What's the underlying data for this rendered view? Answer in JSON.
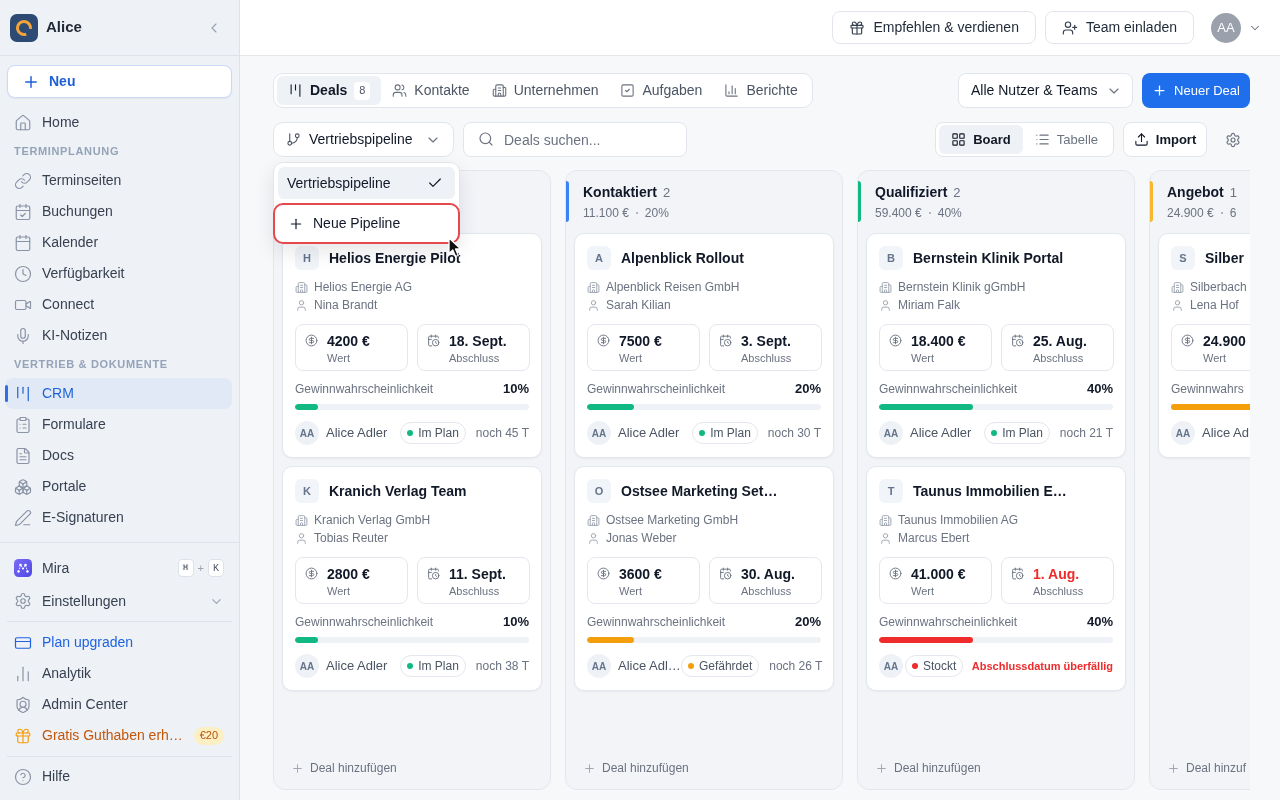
{
  "sidebar": {
    "workspace": "Alice",
    "new_button": "Neu",
    "nav": [
      {
        "kind": "link",
        "label": "Home",
        "selected": false
      },
      {
        "kind": "section",
        "label": "TERMINPLANUNG"
      },
      {
        "kind": "link",
        "label": "Terminseiten",
        "selected": false
      },
      {
        "kind": "link",
        "label": "Buchungen",
        "selected": false
      },
      {
        "kind": "link",
        "label": "Kalender",
        "selected": false
      },
      {
        "kind": "link",
        "label": "Verfügbarkeit",
        "selected": false
      },
      {
        "kind": "link",
        "label": "Connect",
        "selected": false
      },
      {
        "kind": "link",
        "label": "KI-Notizen",
        "selected": false
      },
      {
        "kind": "section",
        "label": "VERTRIEB & DOKUMENTE"
      },
      {
        "kind": "link",
        "label": "CRM",
        "selected": true
      },
      {
        "kind": "link",
        "label": "Formulare",
        "selected": false
      },
      {
        "kind": "link",
        "label": "Docs",
        "selected": false
      },
      {
        "kind": "link",
        "label": "Portale",
        "selected": false
      },
      {
        "kind": "link",
        "label": "E-Signaturen",
        "selected": false
      }
    ],
    "tools": [
      {
        "kind": "assistant",
        "label": "Mira",
        "shortcut": [
          "⌘",
          "+",
          "K"
        ]
      },
      {
        "kind": "expandable",
        "label": "Einstellungen",
        "expanded": false
      }
    ],
    "account": [
      {
        "kind": "upgrade",
        "label": "Plan upgraden"
      },
      {
        "kind": "link",
        "label": "Analytik"
      },
      {
        "kind": "link",
        "label": "Admin Center"
      },
      {
        "kind": "promo",
        "label": "Gratis Guthaben erh…",
        "badge": "€20"
      }
    ],
    "help": "Hilfe"
  },
  "top_bar": {
    "buttons": [
      "Empfehlen & verdienen",
      "Team einladen"
    ],
    "avatar": "AA"
  },
  "tabs": [
    {
      "label": "Deals",
      "count": "8",
      "selected": true
    },
    {
      "label": "Kontakte",
      "selected": false
    },
    {
      "label": "Unternehmen",
      "selected": false
    },
    {
      "label": "Aufgaben",
      "selected": false
    },
    {
      "label": "Berichte",
      "selected": false
    }
  ],
  "owner_filter": "Alle Nutzer & Teams",
  "new_deal_button": "Neuer Deal",
  "pipeline_select": {
    "value": "Vertriebspipeline",
    "expanded": true,
    "menu": [
      {
        "kind": "option",
        "label": "Vertriebspipeline",
        "selected": true,
        "highlighted": false
      },
      {
        "kind": "action",
        "label": "Neue Pipeline",
        "selected": false,
        "highlighted": true
      }
    ]
  },
  "search": {
    "placeholder": "Deals suchen..."
  },
  "view_toggle": [
    {
      "label": "Board",
      "selected": true
    },
    {
      "label": "Tabelle",
      "selected": false
    }
  ],
  "import_button": "Import",
  "columns": [
    {
      "cards": [
        {
          "initial": "H",
          "title": "Helios Energie Pilot",
          "company": "Helios Energie AG",
          "contact": "Nina Brandt",
          "value": "4200 €",
          "value_label": "Wert",
          "close_date": "18. Sept.",
          "close_label": "Abschluss",
          "overdue": false,
          "probability_label": "Gewinnwahrscheinlichkeit",
          "probability": "10%",
          "level": 0.1,
          "color": "#10b981",
          "owner_initials": "AA",
          "owner": "Alice Adler",
          "status": "Im Plan",
          "due": "noch 45 T"
        },
        {
          "initial": "K",
          "title": "Kranich Verlag Team",
          "company": "Kranich Verlag GmbH",
          "contact": "Tobias Reuter",
          "value": "2800 €",
          "value_label": "Wert",
          "close_date": "11. Sept.",
          "close_label": "Abschluss",
          "overdue": false,
          "probability_label": "Gewinnwahrscheinlichkeit",
          "probability": "10%",
          "level": 0.1,
          "color": "#10b981",
          "owner_initials": "AA",
          "owner": "Alice Adler",
          "status": "Im Plan",
          "due": "noch 38 T"
        }
      ],
      "add_button": "Deal hinzufügen"
    },
    {
      "title": "Kontaktiert",
      "count": "2",
      "total": "11.100 €",
      "probability": "20%",
      "color": "#3b82f6",
      "cards": [
        {
          "initial": "A",
          "title": "Alpenblick Rollout",
          "company": "Alpenblick Reisen GmbH",
          "contact": "Sarah Kilian",
          "value": "7500 €",
          "value_label": "Wert",
          "close_date": "3. Sept.",
          "close_label": "Abschluss",
          "overdue": false,
          "probability_label": "Gewinnwahrscheinlichkeit",
          "probability": "20%",
          "level": 0.2,
          "color": "#10b981",
          "owner_initials": "AA",
          "owner": "Alice Adler",
          "status": "Im Plan",
          "due": "noch 30 T"
        },
        {
          "initial": "O",
          "title": "Ostsee Marketing Set…",
          "company": "Ostsee Marketing GmbH",
          "contact": "Jonas Weber",
          "value": "3600 €",
          "value_label": "Wert",
          "close_date": "30. Aug.",
          "close_label": "Abschluss",
          "overdue": false,
          "probability_label": "Gewinnwahrscheinlichkeit",
          "probability": "20%",
          "level": 0.2,
          "color": "#f59e0b",
          "owner_initials": "AA",
          "owner": "Alice Adl…",
          "status": "Gefährdet",
          "due": "noch 26 T"
        }
      ],
      "add_button": "Deal hinzufügen"
    },
    {
      "title": "Qualifiziert",
      "count": "2",
      "total": "59.400 €",
      "probability": "40%",
      "color": "#10b981",
      "cards": [
        {
          "initial": "B",
          "title": "Bernstein Klinik Portal",
          "company": "Bernstein Klinik gGmbH",
          "contact": "Miriam Falk",
          "value": "18.400 €",
          "value_label": "Wert",
          "close_date": "25. Aug.",
          "close_label": "Abschluss",
          "overdue": false,
          "probability_label": "Gewinnwahrscheinlichkeit",
          "probability": "40%",
          "level": 0.4,
          "color": "#10b981",
          "owner_initials": "AA",
          "owner": "Alice Adler",
          "status": "Im Plan",
          "due": "noch 21 T"
        },
        {
          "initial": "T",
          "title": "Taunus Immobilien E…",
          "company": "Taunus Immobilien AG",
          "contact": "Marcus Ebert",
          "value": "41.000 €",
          "value_label": "Wert",
          "close_date": "1. Aug.",
          "close_label": "Abschluss",
          "overdue": true,
          "probability_label": "Gewinnwahrscheinlichkeit",
          "probability": "40%",
          "level": 0.4,
          "color": "#ef2b2b",
          "owner_initials": "AA",
          "status": "Stockt",
          "due": "Abschlussdatum überfällig"
        }
      ],
      "add_button": "Deal hinzufügen"
    },
    {
      "title": "Angebot",
      "count": "1",
      "total": "24.900 €",
      "probability": "6",
      "color": "#f5b82e",
      "cards": [
        {
          "initial": "S",
          "title": "Silber",
          "company": "Silberbach",
          "contact": "Lena Hof",
          "value": "24.900",
          "value_label": "Wert",
          "probability_label": "Gewinnwahrs",
          "color": "#f59e0b",
          "owner_initials": "AA",
          "owner": "Alice Ad"
        }
      ],
      "add_button": "Deal hinzuf"
    }
  ]
}
